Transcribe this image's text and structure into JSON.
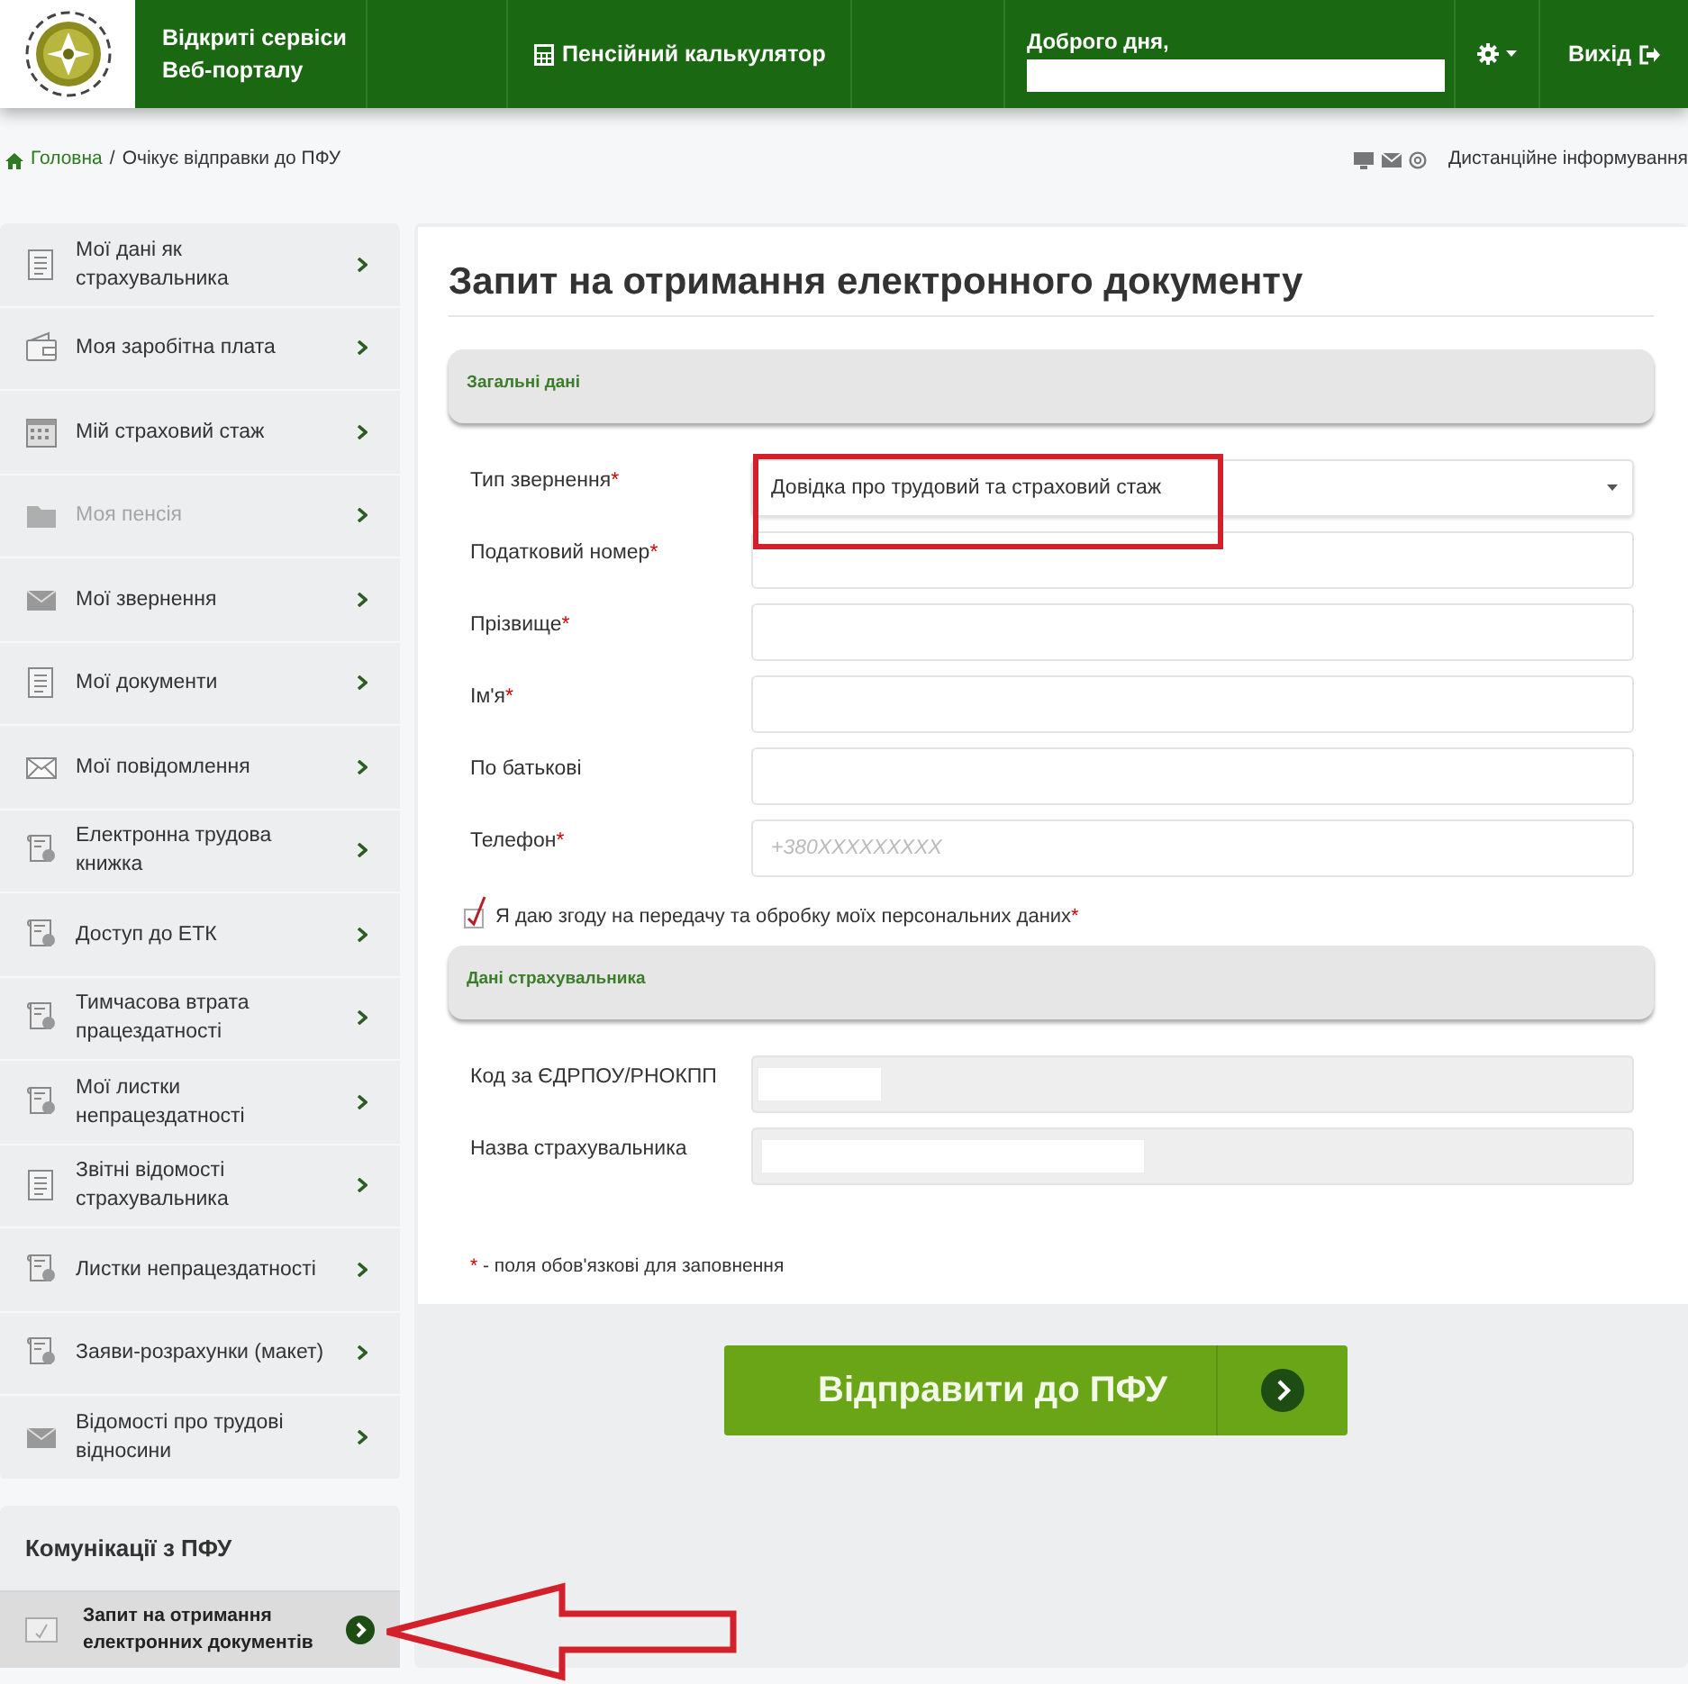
{
  "header": {
    "title_lines": [
      "Відкриті сервіси",
      "Веб-порталу"
    ],
    "calculator": "Пенсійний калькулятор",
    "greeting": "Доброго дня,",
    "greeting_name_redacted": true,
    "logout": "Вихід"
  },
  "breadcrumb": {
    "home": "Головна",
    "separator": "/",
    "current": "Очікує відправки до ПФУ",
    "right_link": "Дистанційне інформування"
  },
  "sidebar": {
    "items": [
      {
        "label": "Мої дані як страхувальника",
        "kind": "document",
        "disabled": false
      },
      {
        "label": "Моя заробітна плата",
        "kind": "wallet",
        "disabled": false
      },
      {
        "label": "Мій страховий стаж",
        "kind": "calendar",
        "disabled": false
      },
      {
        "label": "Моя пенсія",
        "kind": "folder",
        "disabled": true
      },
      {
        "label": "Мої звернення",
        "kind": "envelope",
        "disabled": false
      },
      {
        "label": "Мої документи",
        "kind": "document",
        "disabled": false
      },
      {
        "label": "Мої повідомлення",
        "kind": "letter",
        "disabled": false
      },
      {
        "label": "Електронна трудова книжка",
        "kind": "certificate",
        "disabled": false
      },
      {
        "label": "Доступ до ЕТК",
        "kind": "certificate",
        "disabled": false
      },
      {
        "label": "Тимчасова втрата працездатності",
        "kind": "certificate",
        "disabled": false
      },
      {
        "label": "Мої листки непрацездатності",
        "kind": "certificate",
        "disabled": false
      },
      {
        "label": "Звітні відомості страхувальника",
        "kind": "document",
        "disabled": false
      },
      {
        "label": "Листки непрацездатності",
        "kind": "certificate",
        "disabled": false
      },
      {
        "label": "Заяви-розрахунки (макет)",
        "kind": "certificate",
        "disabled": false
      },
      {
        "label": "Відомості про трудові відносини",
        "kind": "envelope",
        "disabled": false
      }
    ]
  },
  "communications": {
    "title": "Комунікації з ПФУ",
    "items": [
      {
        "label": "Запит на отримання електронних документів",
        "selected": true
      }
    ]
  },
  "form": {
    "title": "Запит на отримання електронного документу",
    "sections": [
      {
        "title": "Загальні дані",
        "fields": [
          {
            "label": "Тип звернення",
            "required_mark": "*",
            "kind": "select",
            "value": "Довідка про трудовий та страховий стаж",
            "highlighted": true
          },
          {
            "label": "Податковий номер",
            "required_mark": "*",
            "kind": "input"
          },
          {
            "label": "Прізвище",
            "required_mark": "*",
            "kind": "input"
          },
          {
            "label": "Ім'я",
            "required_mark": "*",
            "kind": "input"
          },
          {
            "label": "По батькові",
            "kind": "input"
          },
          {
            "label": "Телефон",
            "required_mark": "*",
            "kind": "input",
            "placeholder": "+380XXXXXXXXX"
          }
        ],
        "consent": {
          "label": "Я даю згоду на передачу та обробку моїх персональних даних",
          "required_mark": "*",
          "checked": true
        }
      },
      {
        "title": "Дані страхувальника",
        "fields": [
          {
            "label": "Код за ЄДРПОУ/РНОКПП",
            "kind": "readonly",
            "redacted": true
          },
          {
            "label": "Назва страхувальника",
            "kind": "readonly",
            "redacted": true
          }
        ]
      }
    ],
    "footnote": {
      "mark": "*",
      "text": "- поля обов'язкові для заповнення"
    },
    "submit": "Відправити до ПФУ"
  }
}
